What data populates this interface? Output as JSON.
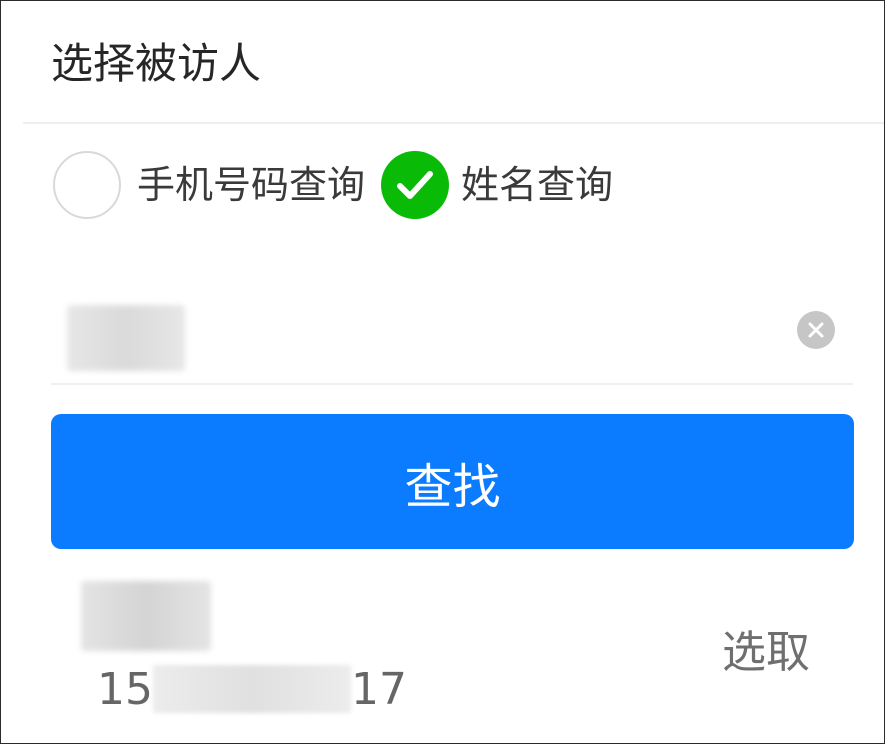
{
  "header": {
    "title": "选择被访人"
  },
  "search_mode": {
    "options": [
      {
        "label": "手机号码查询",
        "checked": false
      },
      {
        "label": "姓名查询",
        "checked": true
      }
    ],
    "check_color": "#09bb07"
  },
  "search_input": {
    "value": "",
    "clear_icon": "clear-circle-icon"
  },
  "search_button": {
    "label": "查找",
    "color": "#0b7bff"
  },
  "results": [
    {
      "name": "",
      "phone_prefix": "15",
      "phone_suffix": "17",
      "action_label": "选取"
    }
  ]
}
